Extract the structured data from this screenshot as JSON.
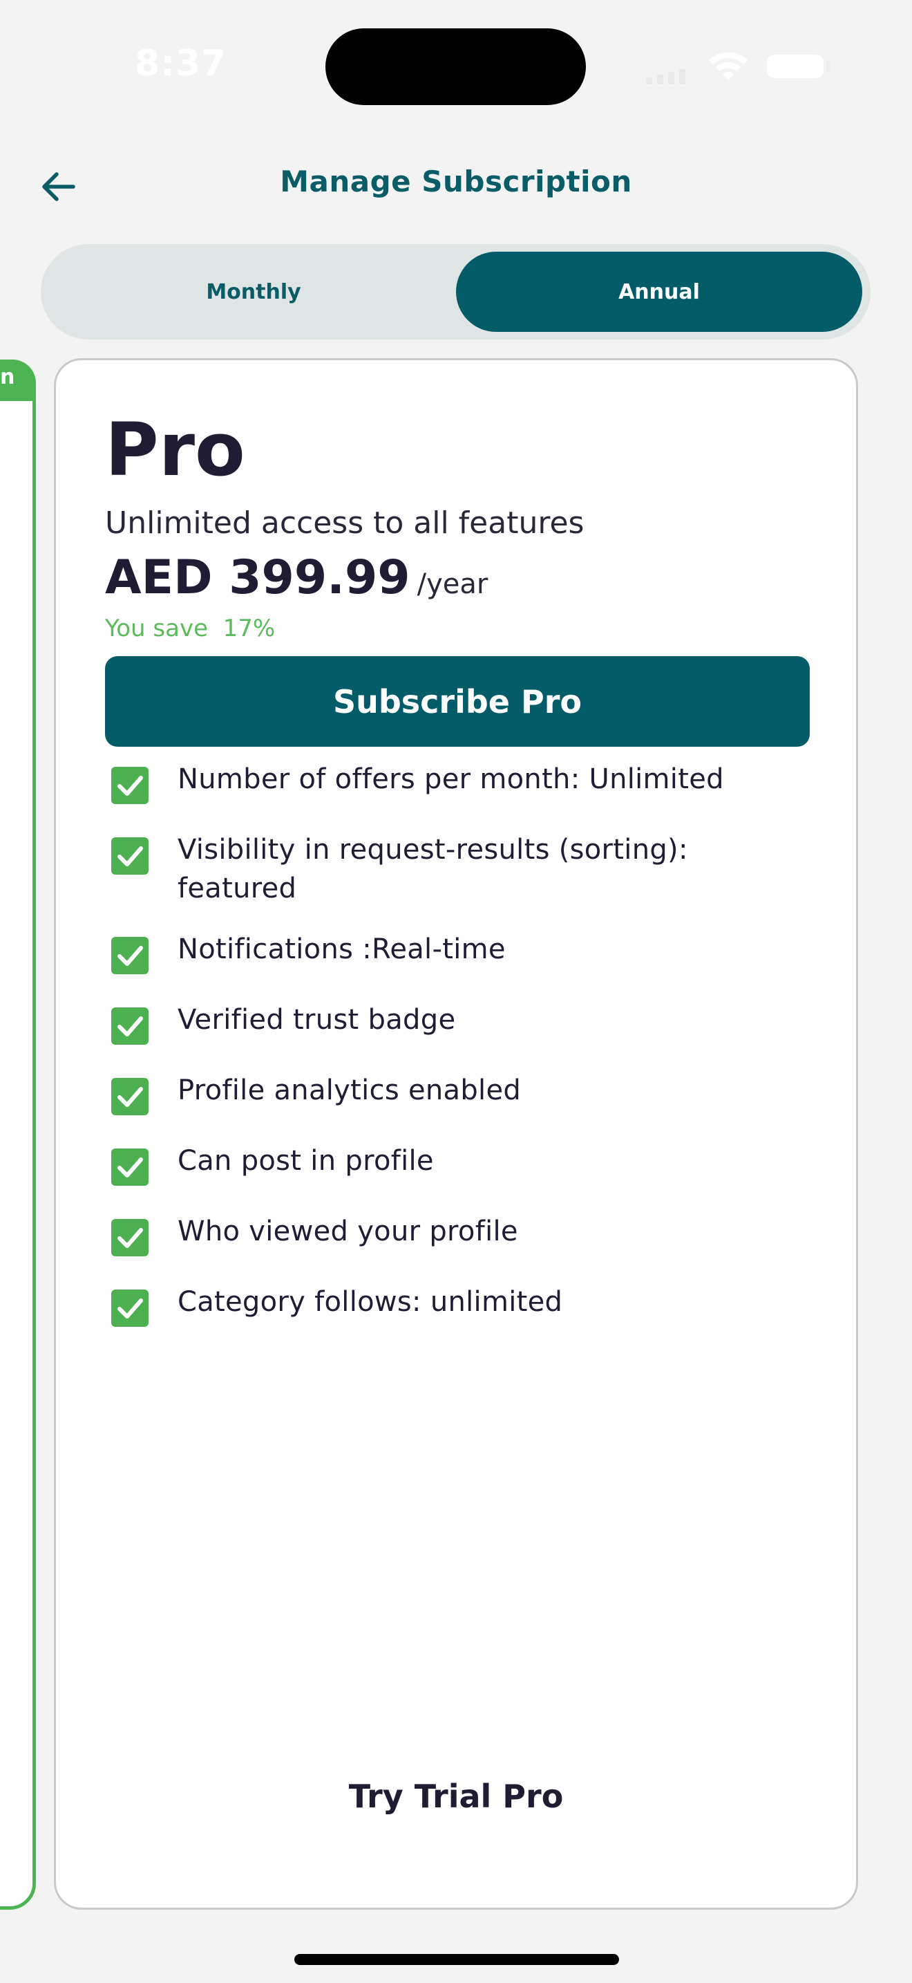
{
  "status_bar": {
    "time": "8:37"
  },
  "header": {
    "title": "Manage Subscription"
  },
  "billing_toggle": {
    "monthly_label": "Monthly",
    "annual_label": "Annual",
    "selected": "Annual"
  },
  "previous_card": {
    "tab_fragment": "n"
  },
  "plan": {
    "name": "Pro",
    "description": "Unlimited access to all features",
    "price": "AED 399.99",
    "period": "/year",
    "savings": "You save  17%",
    "subscribe_label": "Subscribe Pro",
    "features": [
      "Number of offers per month: Unlimited",
      "Visibility in request-results (sorting): featured",
      "Notifications :Real-time",
      "Verified trust badge",
      "Profile analytics enabled",
      "Can post in profile",
      "Who viewed your profile",
      "Category follows: unlimited"
    ],
    "trial_label": "Try Trial Pro"
  },
  "colors": {
    "brand_teal": "#045c68",
    "title_teal": "#0a5c66",
    "check_green": "#4caf50",
    "savings_green": "#5dba5d",
    "background": "#f4f3f4"
  },
  "icons": {
    "back": "arrow-left-icon",
    "feature_check": "checkbox-checked-icon",
    "wifi": "wifi-icon",
    "battery": "battery-icon",
    "signal": "signal-icon"
  }
}
